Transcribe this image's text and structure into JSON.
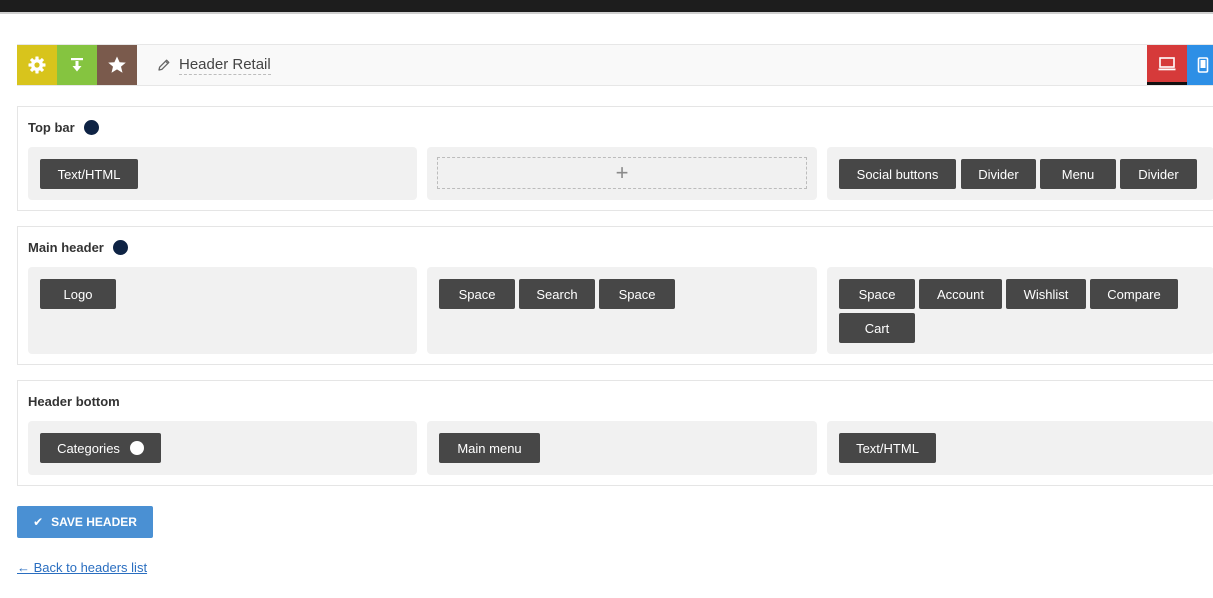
{
  "toolbar": {
    "title": "Header Retail",
    "icons": {
      "settings": "gear-icon",
      "import": "import-icon",
      "favorite": "star-icon",
      "edit": "pencil-icon",
      "desktop": "desktop-icon",
      "mobile": "mobile-icon"
    },
    "colors": {
      "settings": "#d8c41c",
      "import": "#85c440",
      "favorite": "#7a5a4c",
      "desktop": "#d63a3a",
      "mobile": "#2d8fe6"
    }
  },
  "rows": {
    "top_bar": {
      "title": "Top bar",
      "left": [
        "Text/HTML"
      ],
      "center_add": "+",
      "right": [
        "Social buttons",
        "Divider",
        "Menu",
        "Divider"
      ]
    },
    "main_header": {
      "title": "Main header",
      "left": [
        "Logo"
      ],
      "center": [
        "Space",
        "Search",
        "Space"
      ],
      "right": [
        "Space",
        "Account",
        "Wishlist",
        "Compare",
        "Cart"
      ]
    },
    "header_bottom": {
      "title": "Header bottom",
      "left": [
        "Categories"
      ],
      "center": [
        "Main menu"
      ],
      "right": [
        "Text/HTML"
      ]
    }
  },
  "actions": {
    "save_label": "SAVE HEADER",
    "back_label": "← Back to headers list"
  }
}
